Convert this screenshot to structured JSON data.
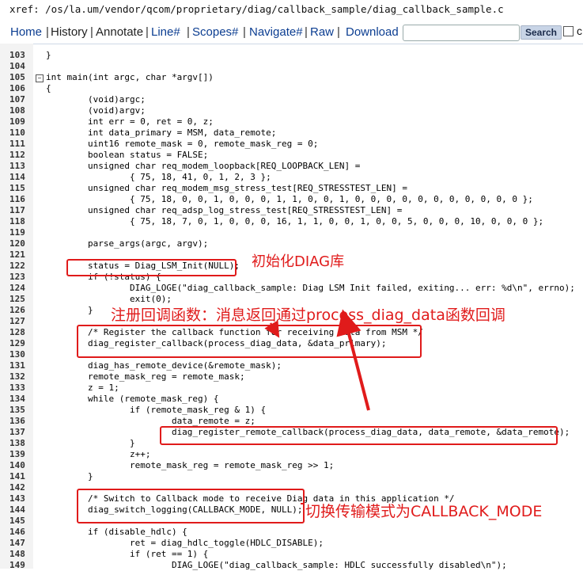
{
  "header": {
    "xref_path": "xref: /os/la.um/vendor/qcom/proprietary/diag/callback_sample/diag_callback_sample.c"
  },
  "nav": {
    "items": [
      "Home",
      "History",
      "Annotate",
      "Line#",
      "Scopes#",
      "Navigate#",
      "Raw",
      "Download"
    ],
    "search_placeholder": "",
    "search_button": "Search",
    "checkbox_label": "c"
  },
  "code": {
    "lines": [
      {
        "n": "103",
        "t": "}"
      },
      {
        "n": "104",
        "t": ""
      },
      {
        "n": "105",
        "t": "int main(int argc, char *argv[])"
      },
      {
        "n": "106",
        "t": "{"
      },
      {
        "n": "107",
        "t": "        (void)argc;"
      },
      {
        "n": "108",
        "t": "        (void)argv;"
      },
      {
        "n": "109",
        "t": "        int err = 0, ret = 0, z;"
      },
      {
        "n": "110",
        "t": "        int data_primary = MSM, data_remote;"
      },
      {
        "n": "111",
        "t": "        uint16 remote_mask = 0, remote_mask_reg = 0;"
      },
      {
        "n": "112",
        "t": "        boolean status = FALSE;"
      },
      {
        "n": "113",
        "t": "        unsigned char req_modem_loopback[REQ_LOOPBACK_LEN] ="
      },
      {
        "n": "114",
        "t": "                { 75, 18, 41, 0, 1, 2, 3 };"
      },
      {
        "n": "115",
        "t": "        unsigned char req_modem_msg_stress_test[REQ_STRESSTEST_LEN] ="
      },
      {
        "n": "116",
        "t": "                { 75, 18, 0, 0, 1, 0, 0, 0, 1, 1, 0, 0, 1, 0, 0, 0, 0, 0, 0, 0, 0, 0, 0, 0 };"
      },
      {
        "n": "117",
        "t": "        unsigned char req_adsp_log_stress_test[REQ_STRESSTEST_LEN] ="
      },
      {
        "n": "118",
        "t": "                { 75, 18, 7, 0, 1, 0, 0, 0, 16, 1, 1, 0, 0, 1, 0, 0, 5, 0, 0, 0, 10, 0, 0, 0 };"
      },
      {
        "n": "119",
        "t": ""
      },
      {
        "n": "120",
        "t": "        parse_args(argc, argv);"
      },
      {
        "n": "121",
        "t": ""
      },
      {
        "n": "122",
        "t": "        status = Diag_LSM_Init(NULL);"
      },
      {
        "n": "123",
        "t": "        if (!status) {"
      },
      {
        "n": "124",
        "t": "                DIAG_LOGE(\"diag_callback_sample: Diag LSM Init failed, exiting... err: %d\\n\", errno);"
      },
      {
        "n": "125",
        "t": "                exit(0);"
      },
      {
        "n": "126",
        "t": "        }"
      },
      {
        "n": "127",
        "t": ""
      },
      {
        "n": "128",
        "t": "        /* Register the callback function for receiving data from MSM */"
      },
      {
        "n": "129",
        "t": "        diag_register_callback(process_diag_data, &data_primary);"
      },
      {
        "n": "130",
        "t": ""
      },
      {
        "n": "131",
        "t": "        diag_has_remote_device(&remote_mask);"
      },
      {
        "n": "132",
        "t": "        remote_mask_reg = remote_mask;"
      },
      {
        "n": "133",
        "t": "        z = 1;"
      },
      {
        "n": "134",
        "t": "        while (remote_mask_reg) {"
      },
      {
        "n": "135",
        "t": "                if (remote_mask_reg & 1) {"
      },
      {
        "n": "136",
        "t": "                        data_remote = z;"
      },
      {
        "n": "137",
        "t": "                        diag_register_remote_callback(process_diag_data, data_remote, &data_remote);"
      },
      {
        "n": "138",
        "t": "                }"
      },
      {
        "n": "139",
        "t": "                z++;"
      },
      {
        "n": "140",
        "t": "                remote_mask_reg = remote_mask_reg >> 1;"
      },
      {
        "n": "141",
        "t": "        }"
      },
      {
        "n": "142",
        "t": ""
      },
      {
        "n": "143",
        "t": "        /* Switch to Callback mode to receive Diag data in this application */"
      },
      {
        "n": "144",
        "t": "        diag_switch_logging(CALLBACK_MODE, NULL);"
      },
      {
        "n": "145",
        "t": ""
      },
      {
        "n": "146",
        "t": "        if (disable_hdlc) {"
      },
      {
        "n": "147",
        "t": "                ret = diag_hdlc_toggle(HDLC_DISABLE);"
      },
      {
        "n": "148",
        "t": "                if (ret == 1) {"
      },
      {
        "n": "149",
        "t": "                        DIAG_LOGE(\"diag_callback_sample: HDLC successfully disabled\\n\");"
      }
    ]
  },
  "annotations": {
    "init": "初始化DIAG库",
    "register": "注册回调函数：消息返回通过process_diag_data函数回调",
    "switch_mode": "切换传输模式为CALLBACK_MODE"
  },
  "colors": {
    "annotation": "#e01b1b",
    "link": "#0b3d91"
  }
}
